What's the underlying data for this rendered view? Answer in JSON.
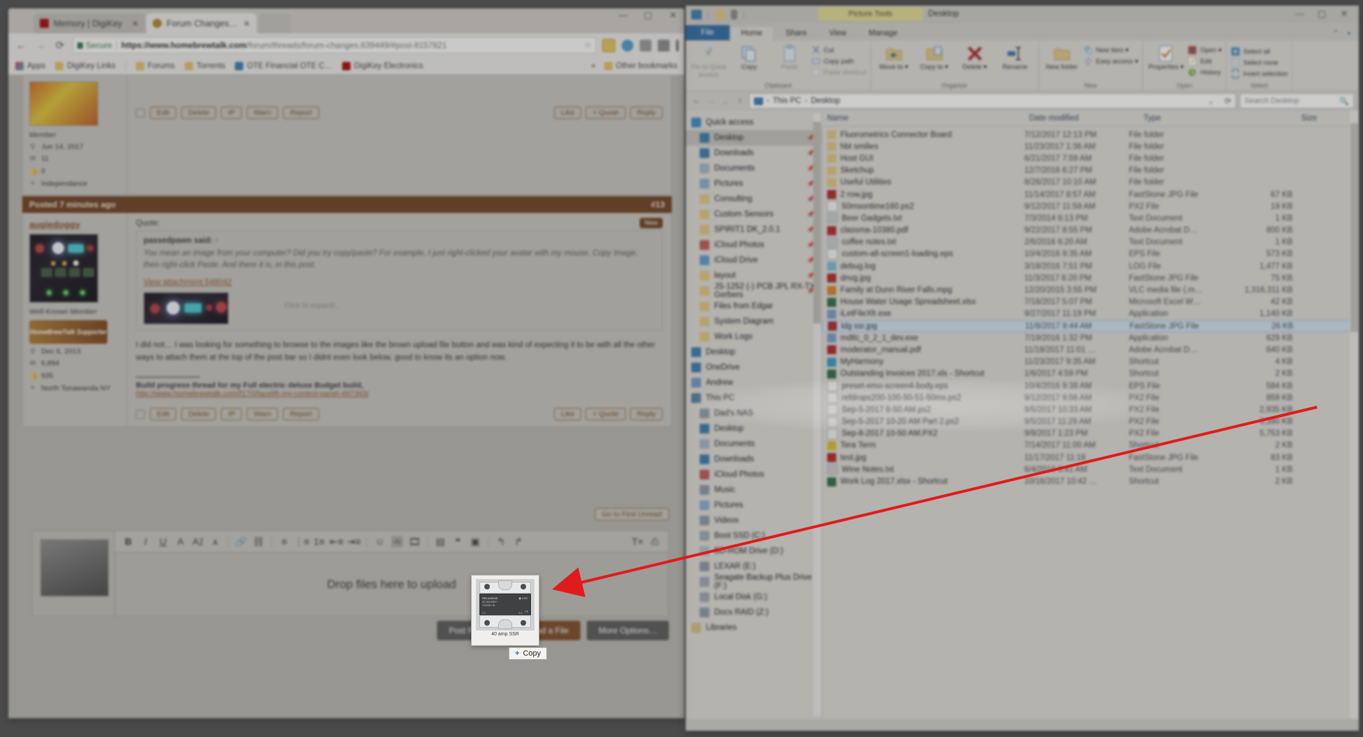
{
  "browser": {
    "tabs": [
      {
        "label": "Memory | DigiKey",
        "favicon": "digikey-icon",
        "active": false
      },
      {
        "label": "Forum Changes | Home…",
        "favicon": "homebrewtalk-icon",
        "active": true
      }
    ],
    "window_buttons": [
      "minimize",
      "maximize",
      "close"
    ],
    "nav": {
      "back": "back-arrow",
      "forward": "forward-arrow",
      "reload": "reload-icon"
    },
    "address": {
      "security_label": "Secure",
      "url_host": "https://www.homebrewtalk.com",
      "url_path": "/forum/threads/forum-changes.639449/#post-8157821",
      "star": "bookmark-star-icon"
    },
    "bookmarks": [
      {
        "label": "Apps",
        "icon": "apps-icon"
      },
      {
        "label": "DigiKey Links",
        "icon": "folder-icon"
      },
      {
        "label": "Forums",
        "icon": "folder-icon"
      },
      {
        "label": "Torrents",
        "icon": "folder-icon"
      },
      {
        "label": "OTE Financial OTE C…",
        "icon": "ote-icon"
      },
      {
        "label": "DigiKey Electronics",
        "icon": "digikey-icon"
      },
      {
        "label": "Other bookmarks",
        "icon": "folder-icon"
      }
    ],
    "bookmarks_overflow": "»"
  },
  "forum": {
    "post_top": {
      "member_role": "Member",
      "joined": "Jun 14, 2017",
      "messages": "11",
      "likes": "0",
      "location": "Independance",
      "actions": [
        "Edit",
        "Delete",
        "IP",
        "Warn",
        "Report"
      ],
      "right_actions": [
        "Like",
        "+ Quote",
        "Reply"
      ]
    },
    "post": {
      "posted_label": "Posted 7 minutes ago",
      "post_number": "#13",
      "new_badge": "New",
      "username": "augiedoggy",
      "member_role": "Well-Known Member",
      "supporter_badge": "HomeBrewTalk Supporter",
      "joined": "Dec 6, 2013",
      "messages": "6,894",
      "likes": "935",
      "location": "North Tonawanda NY",
      "quote_label": "Quote:",
      "quote_author": "passedpawn said:",
      "quote_text": "You mean an image from your computer? Did you try copy/paste? For example, I just right-clicked your avatar with my mouse, Copy Image, then right-click Paste. And there it is, in this post.",
      "quote_attachment": "View attachment 548042",
      "expand_hint": "Click to expand...",
      "body": "I did not… I was looking for something to browse to the images like the brown upload file button and was kind of expecting it to be with all the other ways to attach them at the top of the post bar so I didnt even look below. good to know its an option now.",
      "signature": "Build progress thread for my Full electric deluxe Budget build,",
      "signature_link": "http://www.homebrewtalk.com/f170/facelift-my-control-panel-497393/",
      "actions": [
        "Edit",
        "Delete",
        "IP",
        "Warn",
        "Report"
      ],
      "right_actions": [
        "Like",
        "+ Quote",
        "Reply"
      ]
    },
    "go_first_unread": "Go to First Unread",
    "editor": {
      "toolbar_icons": [
        "bold",
        "italic",
        "underline",
        "text-color",
        "font-size",
        "font-family",
        "link",
        "unlink",
        "align",
        "list-bullet",
        "list-number",
        "indent-decrease",
        "indent-increase",
        "emoji",
        "image",
        "media",
        "table",
        "drafts",
        "undo",
        "redo",
        "remove-format",
        "preview"
      ],
      "dropzone_text": "Drop files here to upload",
      "buttons": [
        {
          "label": "Post Reply",
          "color": "#5a5a5a"
        },
        {
          "label": "Upload a File",
          "color": "#8a4a1c"
        },
        {
          "label": "More Options…",
          "color": "#5a5a5a"
        }
      ]
    }
  },
  "drag": {
    "thumbnail_caption": "40 amp SSR",
    "tooltip_label": "Copy",
    "tooltip_plus": "+"
  },
  "explorer": {
    "window_title": "Desktop",
    "contextual_tab": "Picture Tools",
    "quick_access_icons": [
      "explorer-icon",
      "properties-icon",
      "new-folder-icon",
      "customize-chevron-icon"
    ],
    "window_buttons": [
      "minimize",
      "restore",
      "close"
    ],
    "ribbon_tabs": [
      {
        "label": "File",
        "kind": "file"
      },
      {
        "label": "Home",
        "kind": "selected"
      },
      {
        "label": "Share",
        "kind": "normal"
      },
      {
        "label": "View",
        "kind": "normal"
      },
      {
        "label": "Manage",
        "kind": "contextual"
      }
    ],
    "ribbon_groups": [
      {
        "name": "Clipboard",
        "big": [
          {
            "label": "Pin to Quick access",
            "icon": "pin-icon",
            "disabled": true
          },
          {
            "label": "Copy",
            "icon": "copy-icon",
            "disabled": false
          },
          {
            "label": "Paste",
            "icon": "paste-icon",
            "disabled": true
          }
        ],
        "small": [
          {
            "label": "Cut",
            "icon": "cut-icon",
            "disabled": false
          },
          {
            "label": "Copy path",
            "icon": "copy-path-icon",
            "disabled": false
          },
          {
            "label": "Paste shortcut",
            "icon": "paste-shortcut-icon",
            "disabled": true
          }
        ]
      },
      {
        "name": "Organize",
        "big": [
          {
            "label": "Move to ▾",
            "icon": "move-to-icon",
            "disabled": false
          },
          {
            "label": "Copy to ▾",
            "icon": "copy-to-icon",
            "disabled": false
          },
          {
            "label": "Delete ▾",
            "icon": "delete-icon",
            "disabled": false
          },
          {
            "label": "Rename",
            "icon": "rename-icon",
            "disabled": false
          }
        ],
        "small": []
      },
      {
        "name": "New",
        "big": [
          {
            "label": "New folder",
            "icon": "new-folder-icon",
            "disabled": false
          }
        ],
        "small": [
          {
            "label": "New item ▾",
            "icon": "new-item-icon",
            "disabled": false
          },
          {
            "label": "Easy access ▾",
            "icon": "easy-access-icon",
            "disabled": false
          }
        ]
      },
      {
        "name": "Open",
        "big": [
          {
            "label": "Properties ▾",
            "icon": "properties-icon",
            "disabled": false
          }
        ],
        "small": [
          {
            "label": "Open ▾",
            "icon": "open-icon",
            "disabled": false
          },
          {
            "label": "Edit",
            "icon": "edit-icon",
            "disabled": false
          },
          {
            "label": "History",
            "icon": "history-icon",
            "disabled": false
          }
        ]
      },
      {
        "name": "Select",
        "big": [],
        "small": [
          {
            "label": "Select all",
            "icon": "select-all-icon",
            "disabled": false
          },
          {
            "label": "Select none",
            "icon": "select-none-icon",
            "disabled": false
          },
          {
            "label": "Invert selection",
            "icon": "invert-selection-icon",
            "disabled": false
          }
        ]
      }
    ],
    "breadcrumb": [
      "This PC",
      "Desktop"
    ],
    "search_placeholder": "Search Desktop",
    "nav_pane": [
      {
        "label": "Quick access",
        "icon": "quick-access-icon",
        "indent": 0,
        "selected": false,
        "pin": false
      },
      {
        "label": "Desktop",
        "icon": "desktop-icon",
        "indent": 1,
        "selected": true,
        "pin": true
      },
      {
        "label": "Downloads",
        "icon": "downloads-icon",
        "indent": 1,
        "selected": false,
        "pin": true
      },
      {
        "label": "Documents",
        "icon": "documents-icon",
        "indent": 1,
        "selected": false,
        "pin": true
      },
      {
        "label": "Pictures",
        "icon": "pictures-icon",
        "indent": 1,
        "selected": false,
        "pin": true
      },
      {
        "label": "Consulting",
        "icon": "folder-icon",
        "indent": 1,
        "selected": false,
        "pin": true
      },
      {
        "label": "Custom Sensors",
        "icon": "folder-icon",
        "indent": 1,
        "selected": false,
        "pin": true
      },
      {
        "label": "SPIRIT1 DK_2.0.1",
        "icon": "folder-icon",
        "indent": 1,
        "selected": false,
        "pin": true
      },
      {
        "label": "iCloud Photos",
        "icon": "icloud-photos-icon",
        "indent": 1,
        "selected": false,
        "pin": true
      },
      {
        "label": "iCloud Drive",
        "icon": "icloud-drive-icon",
        "indent": 1,
        "selected": false,
        "pin": true
      },
      {
        "label": "layout",
        "icon": "folder-icon",
        "indent": 1,
        "selected": false,
        "pin": true
      },
      {
        "label": "JS-1252 (-) PCB JPL RX-TX Gerbers",
        "icon": "folder-icon",
        "indent": 1,
        "selected": false,
        "pin": true
      },
      {
        "label": "Files from Edgar",
        "icon": "folder-icon",
        "indent": 1,
        "selected": false,
        "pin": false
      },
      {
        "label": "System Diagram",
        "icon": "folder-icon",
        "indent": 1,
        "selected": false,
        "pin": false
      },
      {
        "label": "Work Logs",
        "icon": "folder-icon",
        "indent": 1,
        "selected": false,
        "pin": false
      },
      {
        "label": "Desktop",
        "icon": "desktop-icon",
        "indent": 0,
        "selected": false,
        "pin": false
      },
      {
        "label": "OneDrive",
        "icon": "onedrive-icon",
        "indent": 0,
        "selected": false,
        "pin": false
      },
      {
        "label": "Andrew",
        "icon": "user-icon",
        "indent": 0,
        "selected": false,
        "pin": false
      },
      {
        "label": "This PC",
        "icon": "this-pc-icon",
        "indent": 0,
        "selected": false,
        "pin": false
      },
      {
        "label": "Dad's NAS",
        "icon": "network-drive-icon",
        "indent": 1,
        "selected": false,
        "pin": false
      },
      {
        "label": "Desktop",
        "icon": "desktop-icon",
        "indent": 1,
        "selected": false,
        "pin": false
      },
      {
        "label": "Documents",
        "icon": "documents-icon",
        "indent": 1,
        "selected": false,
        "pin": false
      },
      {
        "label": "Downloads",
        "icon": "downloads-icon",
        "indent": 1,
        "selected": false,
        "pin": false
      },
      {
        "label": "iCloud Photos",
        "icon": "icloud-photos-icon",
        "indent": 1,
        "selected": false,
        "pin": false
      },
      {
        "label": "Music",
        "icon": "music-icon",
        "indent": 1,
        "selected": false,
        "pin": false
      },
      {
        "label": "Pictures",
        "icon": "pictures-icon",
        "indent": 1,
        "selected": false,
        "pin": false
      },
      {
        "label": "Videos",
        "icon": "videos-icon",
        "indent": 1,
        "selected": false,
        "pin": false
      },
      {
        "label": "Boot SSD (C:)",
        "icon": "drive-icon",
        "indent": 1,
        "selected": false,
        "pin": false
      },
      {
        "label": "BD-ROM Drive (D:)",
        "icon": "optical-drive-icon",
        "indent": 1,
        "selected": false,
        "pin": false
      },
      {
        "label": "LEXAR (E:)",
        "icon": "usb-drive-icon",
        "indent": 1,
        "selected": false,
        "pin": false
      },
      {
        "label": "Seagate Backup Plus Drive (F:)",
        "icon": "drive-icon",
        "indent": 1,
        "selected": false,
        "pin": false
      },
      {
        "label": "Local Disk (G:)",
        "icon": "drive-icon",
        "indent": 1,
        "selected": false,
        "pin": false
      },
      {
        "label": "Docs RAID (Z:)",
        "icon": "network-drive-icon",
        "indent": 1,
        "selected": false,
        "pin": false
      },
      {
        "label": "Libraries",
        "icon": "libraries-icon",
        "indent": 0,
        "selected": false,
        "pin": false
      }
    ],
    "columns": [
      "Name",
      "Date modified",
      "Type",
      "Size"
    ],
    "sort_column": "Name",
    "files": [
      {
        "name": "Fluorometrics Connector Board",
        "date": "7/12/2017 12:13 PM",
        "type": "File folder",
        "size": "",
        "icon": "folder-icon",
        "selected": false
      },
      {
        "name": "hbt smilies",
        "date": "11/23/2017 1:36 AM",
        "type": "File folder",
        "size": "",
        "icon": "folder-icon",
        "selected": false
      },
      {
        "name": "Host GUI",
        "date": "6/21/2017 7:59 AM",
        "type": "File folder",
        "size": "",
        "icon": "folder-icon",
        "selected": false
      },
      {
        "name": "Sketchup",
        "date": "12/7/2016 6:27 PM",
        "type": "File folder",
        "size": "",
        "icon": "folder-icon",
        "selected": false
      },
      {
        "name": "Useful Utilities",
        "date": "8/26/2017 10:10 AM",
        "type": "File folder",
        "size": "",
        "icon": "folder-icon",
        "selected": false
      },
      {
        "name": "2 row.jpg",
        "date": "11/14/2017 8:57 AM",
        "type": "FastStone JPG File",
        "size": "67 KB",
        "icon": "jpg-icon",
        "selected": false
      },
      {
        "name": "50msontime160.ps2",
        "date": "9/12/2017 11:59 AM",
        "type": "PX2 File",
        "size": "19 KB",
        "icon": "generic-file-icon",
        "selected": false
      },
      {
        "name": "Beer Gadgets.txt",
        "date": "7/3/2014 6:13 PM",
        "type": "Text Document",
        "size": "1 KB",
        "icon": "text-icon",
        "selected": false
      },
      {
        "name": "classma-10380.pdf",
        "date": "9/22/2017 8:55 PM",
        "type": "Adobe Acrobat D…",
        "size": "800 KB",
        "icon": "pdf-icon",
        "selected": false
      },
      {
        "name": "coffee notes.txt",
        "date": "2/6/2016 6:20 AM",
        "type": "Text Document",
        "size": "1 KB",
        "icon": "text-icon",
        "selected": false
      },
      {
        "name": "custom-all-screen1-loading.eps",
        "date": "10/4/2016 9:35 AM",
        "type": "EPS File",
        "size": "573 KB",
        "icon": "generic-file-icon",
        "selected": false
      },
      {
        "name": "debug.log",
        "date": "3/18/2016 7:51 PM",
        "type": "LOG File",
        "size": "1,477 KB",
        "icon": "log-icon",
        "selected": false
      },
      {
        "name": "dnvg.jpg",
        "date": "11/3/2017 6:20 PM",
        "type": "FastStone JPG File",
        "size": "75 KB",
        "icon": "jpg-icon",
        "selected": false
      },
      {
        "name": "Family at Dunn River Falls.mpg",
        "date": "12/20/2015 3:55 PM",
        "type": "VLC media file (.m…",
        "size": "1,316,311 KB",
        "icon": "vlc-icon",
        "selected": false
      },
      {
        "name": "House Water Usage Spreadsheet.xlsx",
        "date": "7/18/2017 5:07 PM",
        "type": "Microsoft Excel W…",
        "size": "42 KB",
        "icon": "excel-icon",
        "selected": false
      },
      {
        "name": "iLetFileXfr.exe",
        "date": "9/27/2017 11:19 PM",
        "type": "Application",
        "size": "1,140 KB",
        "icon": "exe-icon",
        "selected": false
      },
      {
        "name": "ldg ssr.jpg",
        "date": "11/8/2017 9:44 AM",
        "type": "FastStone JPG File",
        "size": "26 KB",
        "icon": "jpg-icon",
        "selected": true
      },
      {
        "name": "mdtlc_0_2_1_dev.exe",
        "date": "7/19/2016 1:32 PM",
        "type": "Application",
        "size": "629 KB",
        "icon": "exe-icon",
        "selected": false
      },
      {
        "name": "moderator_manual.pdf",
        "date": "11/18/2017 11:01 …",
        "type": "Adobe Acrobat D…",
        "size": "640 KB",
        "icon": "pdf-icon",
        "selected": false
      },
      {
        "name": "MyHarmony",
        "date": "11/23/2017 9:35 AM",
        "type": "Shortcut",
        "size": "4 KB",
        "icon": "harmony-icon",
        "selected": false
      },
      {
        "name": "Outstanding Invoices 2017.xls - Shortcut",
        "date": "1/6/2017 4:59 PM",
        "type": "Shortcut",
        "size": "2 KB",
        "icon": "excel-icon",
        "selected": false
      },
      {
        "name": "preset-emo-screen4-body.eps",
        "date": "10/4/2016 9:38 AM",
        "type": "EPS File",
        "size": "584 KB",
        "icon": "generic-file-icon",
        "selected": false
      },
      {
        "name": "refdrops200-100-50-51-50ms.ps2",
        "date": "9/12/2017 9:56 AM",
        "type": "PX2 File",
        "size": "859 KB",
        "icon": "generic-file-icon",
        "selected": false
      },
      {
        "name": "Sep-5-2017 8-50 AM.ps2",
        "date": "9/5/2017 10:33 AM",
        "type": "PX2 File",
        "size": "2,935 KB",
        "icon": "generic-file-icon",
        "selected": false
      },
      {
        "name": "Sep-5-2017 10-20 AM Part 2.ps2",
        "date": "9/5/2017 11:29 AM",
        "type": "PX2 File",
        "size": "3,390 KB",
        "icon": "generic-file-icon",
        "selected": false
      },
      {
        "name": "Sep-8-2017 10-50 AM.PX2",
        "date": "9/8/2017 1:23 PM",
        "type": "PX2 File",
        "size": "5,753 KB",
        "icon": "generic-file-icon",
        "selected": false
      },
      {
        "name": "Tera Term",
        "date": "7/14/2017 11:00 AM",
        "type": "Shortcut",
        "size": "2 KB",
        "icon": "teraterm-icon",
        "selected": false
      },
      {
        "name": "test.jpg",
        "date": "11/17/2017 11:18 …",
        "type": "FastStone JPG File",
        "size": "83 KB",
        "icon": "jpg-icon",
        "selected": false
      },
      {
        "name": "Wine Notes.txt",
        "date": "6/4/2016 8:41 AM",
        "type": "Text Document",
        "size": "1 KB",
        "icon": "text-icon",
        "selected": false
      },
      {
        "name": "Work Log 2017.xlsx - Shortcut",
        "date": "10/16/2017 10:42 …",
        "type": "Shortcut",
        "size": "2 KB",
        "icon": "excel-icon",
        "selected": false
      }
    ]
  },
  "colors": {
    "accent_blue": "#1f6fba",
    "selection_blue": "#cde3f5",
    "forum_brown": "#7a3f16",
    "arrow_red": "#e01b1b",
    "folder_yellow": "#e8c86a",
    "contextual_yellow": "#e2dc7e"
  }
}
